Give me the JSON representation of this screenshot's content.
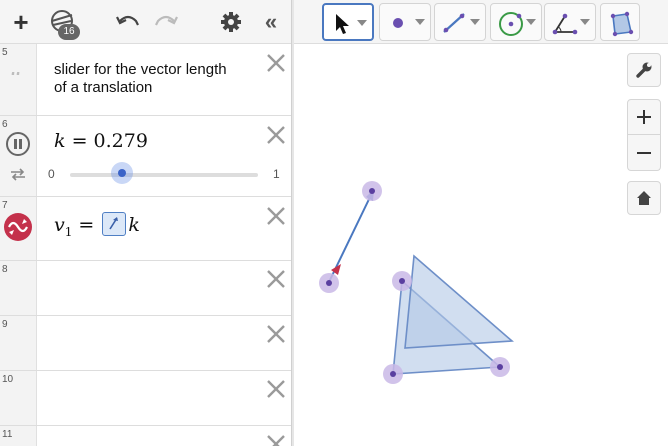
{
  "toolbar": {
    "add_label": "+",
    "style_badge": "16",
    "collapse_label": "«"
  },
  "rows": [
    {
      "num": "5",
      "type": "text",
      "text_line1": "slider for the vector length",
      "text_line2": "of a translation"
    },
    {
      "num": "6",
      "type": "slider",
      "var": "k",
      "eq": "=",
      "value": "0.279",
      "min_label": "0",
      "max_label": "1",
      "slider_fraction": 0.279
    },
    {
      "num": "7",
      "type": "vector",
      "name": "v",
      "sub": "1",
      "eq": "=",
      "factor": "k"
    },
    {
      "num": "8"
    },
    {
      "num": "9"
    },
    {
      "num": "10"
    },
    {
      "num": "11"
    }
  ],
  "icons": {
    "row5": "quote-icon",
    "row6_play": "pause-icon",
    "row6_repeat": "repeat-icon",
    "row7": "translate-object-icon",
    "close": "close-icon"
  },
  "colors": {
    "accent": "#4a78c0",
    "point": "#5a3fa0",
    "point_halo": "#c9b8e6",
    "polygon_fill": "#b3c8e6",
    "polygon_stroke": "#6e8fc8",
    "vector_stroke": "#4a78c0",
    "vector_tail": "#c4314b"
  }
}
